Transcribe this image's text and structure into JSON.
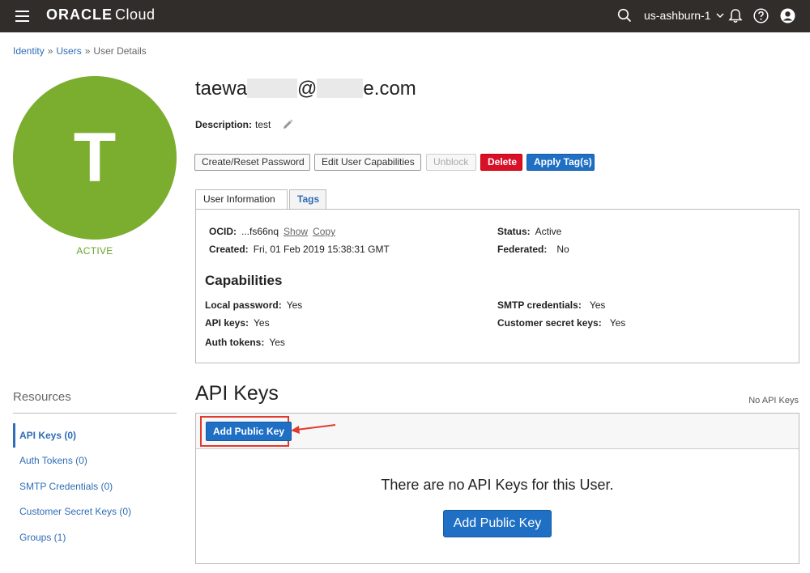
{
  "topbar": {
    "brand_oracle": "ORACLE",
    "brand_cloud": "Cloud",
    "region": "us-ashburn-1"
  },
  "breadcrumb": {
    "identity": "Identity",
    "users": "Users",
    "current": "User Details",
    "separator": "»"
  },
  "user": {
    "initial": "T",
    "state": "ACTIVE",
    "name_prefix": "taewa",
    "name_at": "@",
    "name_suffix": "e.com",
    "description_label": "Description:",
    "description_value": "test"
  },
  "actions": {
    "create_reset_password": "Create/Reset Password",
    "edit_capabilities": "Edit User Capabilities",
    "unblock": "Unblock",
    "delete": "Delete",
    "apply_tags": "Apply Tag(s)"
  },
  "tabs": {
    "user_information": "User Information",
    "tags": "Tags"
  },
  "info": {
    "ocid_label": "OCID:",
    "ocid_value": "...fs66nq",
    "show": "Show",
    "copy": "Copy",
    "created_label": "Created:",
    "created_value": "Fri, 01 Feb 2019 15:38:31 GMT",
    "status_label": "Status:",
    "status_value": "Active",
    "federated_label": "Federated:",
    "federated_value": "No"
  },
  "capabilities": {
    "title": "Capabilities",
    "local_password_label": "Local password:",
    "local_password_value": "Yes",
    "api_keys_label": "API keys:",
    "api_keys_value": "Yes",
    "auth_tokens_label": "Auth tokens:",
    "auth_tokens_value": "Yes",
    "smtp_label": "SMTP credentials:",
    "smtp_value": "Yes",
    "customer_secret_label": "Customer secret keys:",
    "customer_secret_value": "Yes"
  },
  "resources": {
    "title": "Resources",
    "items": [
      {
        "label": "API Keys (0)"
      },
      {
        "label": "Auth Tokens (0)"
      },
      {
        "label": "SMTP Credentials (0)"
      },
      {
        "label": "Customer Secret Keys (0)"
      },
      {
        "label": "Groups (1)"
      }
    ]
  },
  "api_keys": {
    "title": "API Keys",
    "count_text": "No API Keys",
    "add_button": "Add Public Key",
    "empty_message": "There are no API Keys for this User.",
    "add_button_large": "Add Public Key"
  },
  "colors": {
    "topbar": "#312d2a",
    "avatar": "#7bad2f",
    "link": "#2f6db5",
    "primary": "#1f6fc5",
    "danger": "#d9102a",
    "highlight": "#e03a2e"
  },
  "icons": [
    "hamburger-icon",
    "search-icon",
    "chevron-down-icon",
    "bell-icon",
    "help-icon",
    "user-icon",
    "pencil-icon",
    "arrow-icon"
  ]
}
